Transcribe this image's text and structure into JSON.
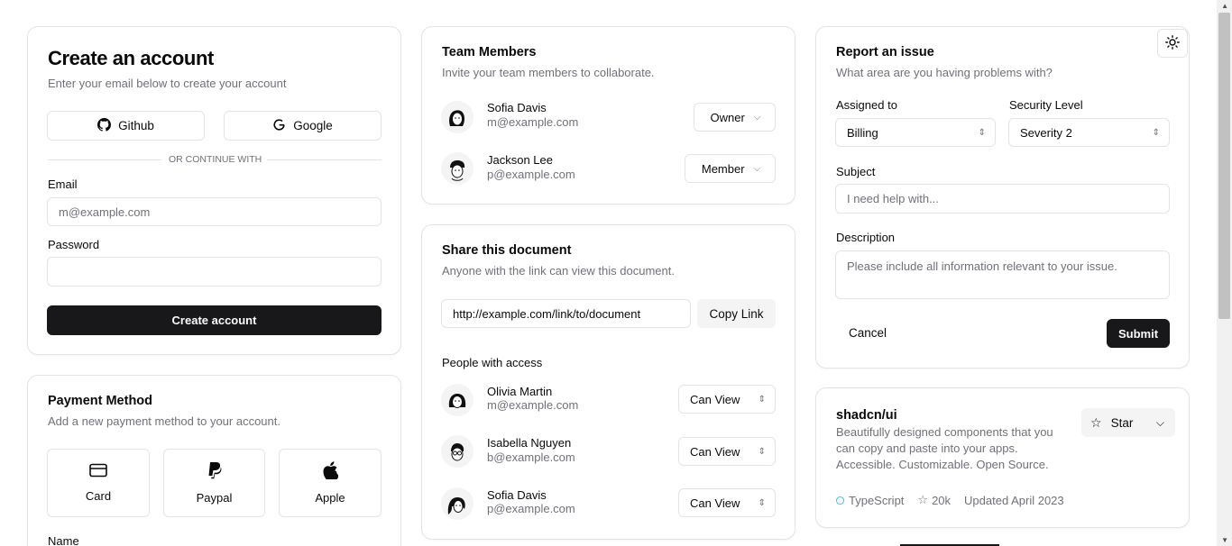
{
  "create_account": {
    "title": "Create an account",
    "subtitle": "Enter your email below to create your account",
    "github_label": "Github",
    "google_label": "Google",
    "divider_text": "OR CONTINUE WITH",
    "email_label": "Email",
    "email_placeholder": "m@example.com",
    "password_label": "Password",
    "submit_label": "Create account"
  },
  "payment": {
    "title": "Payment Method",
    "subtitle": "Add a new payment method to your account.",
    "options": [
      {
        "label": "Card",
        "icon": "credit-card-icon"
      },
      {
        "label": "Paypal",
        "icon": "paypal-icon"
      },
      {
        "label": "Apple",
        "icon": "apple-icon"
      }
    ],
    "name_label": "Name"
  },
  "team": {
    "title": "Team Members",
    "subtitle": "Invite your team members to collaborate.",
    "members": [
      {
        "name": "Sofia Davis",
        "email": "m@example.com",
        "role": "Owner"
      },
      {
        "name": "Jackson Lee",
        "email": "p@example.com",
        "role": "Member"
      }
    ]
  },
  "share": {
    "title": "Share this document",
    "subtitle": "Anyone with the link can view this document.",
    "link_value": "http://example.com/link/to/document",
    "copy_label": "Copy Link",
    "people_heading": "People with access",
    "people": [
      {
        "name": "Olivia Martin",
        "email": "m@example.com",
        "access": "Can View"
      },
      {
        "name": "Isabella Nguyen",
        "email": "b@example.com",
        "access": "Can View"
      },
      {
        "name": "Sofia Davis",
        "email": "p@example.com",
        "access": "Can View"
      }
    ]
  },
  "report": {
    "title": "Report an issue",
    "subtitle": "What area are you having problems with?",
    "assigned_label": "Assigned to",
    "assigned_value": "Billing",
    "security_label": "Security Level",
    "security_value": "Severity 2",
    "subject_label": "Subject",
    "subject_placeholder": "I need help with...",
    "description_label": "Description",
    "description_placeholder": "Please include all information relevant to your issue.",
    "cancel_label": "Cancel",
    "submit_label": "Submit"
  },
  "repo": {
    "title": "shadcn/ui",
    "description": "Beautifully designed components that you can copy and paste into your apps. Accessible. Customizable. Open Source.",
    "star_label": "Star",
    "language": "TypeScript",
    "stars": "20k",
    "updated": "Updated April 2023"
  },
  "colors": {
    "primary": "#18181b",
    "border": "#e4e4e7",
    "muted": "#71717a",
    "language_dot": "#38bdf8"
  }
}
